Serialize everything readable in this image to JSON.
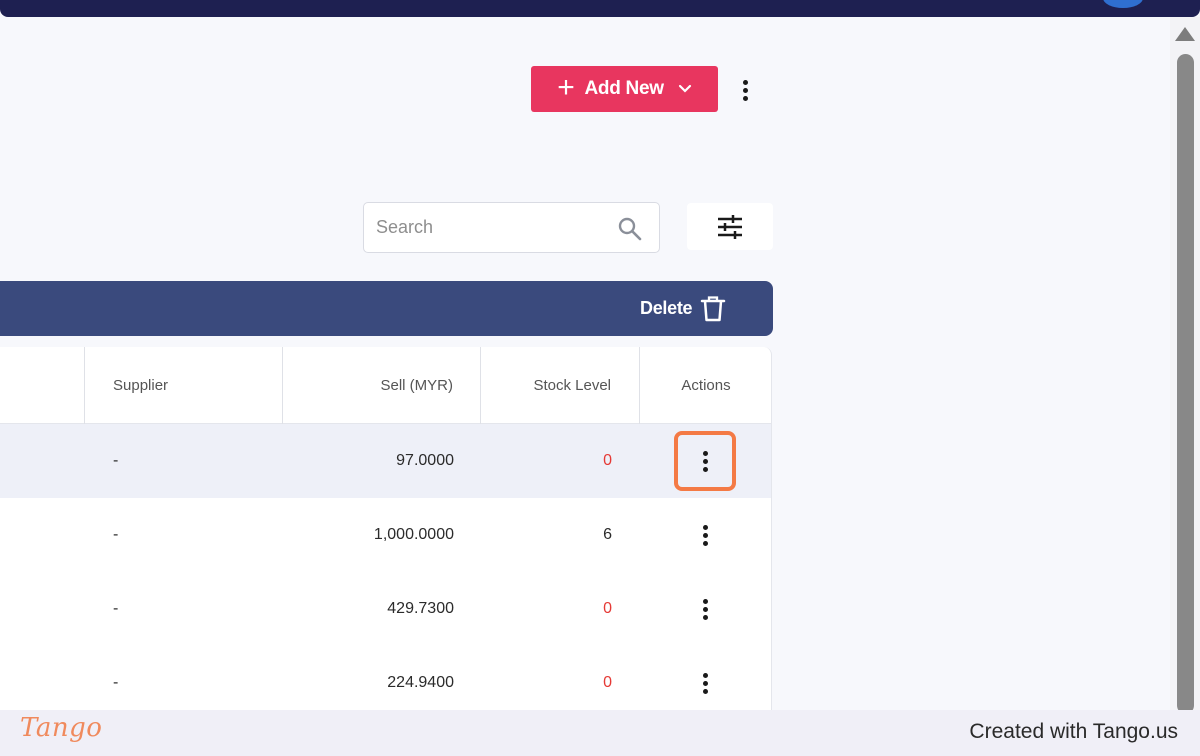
{
  "header": {
    "add_new_label": "Add New",
    "icons": [
      "plus-icon",
      "chevron-down-icon",
      "more-vertical-icon"
    ]
  },
  "search": {
    "placeholder": "Search",
    "value": ""
  },
  "toolbar": {
    "delete_label": "Delete",
    "icons": [
      "filter-sliders-icon",
      "trash-icon",
      "search-icon"
    ]
  },
  "table": {
    "columns": [
      "Supplier",
      "Sell (MYR)",
      "Stock Level",
      "Actions"
    ],
    "rows": [
      {
        "supplier": "-",
        "sell": "97.0000",
        "stock": "0"
      },
      {
        "supplier": "-",
        "sell": "1,000.0000",
        "stock": "6"
      },
      {
        "supplier": "-",
        "sell": "429.7300",
        "stock": "0"
      },
      {
        "supplier": "-",
        "sell": "224.9400",
        "stock": "0"
      }
    ]
  },
  "footer": {
    "logo_text": "Tango",
    "created_with": "Created with Tango.us"
  },
  "colors": {
    "accent": "#e8365f",
    "header_bar": "#3a4a7d",
    "top_strip": "#1e2051",
    "zero_stock": "#e53935",
    "highlight": "#f47a45"
  }
}
